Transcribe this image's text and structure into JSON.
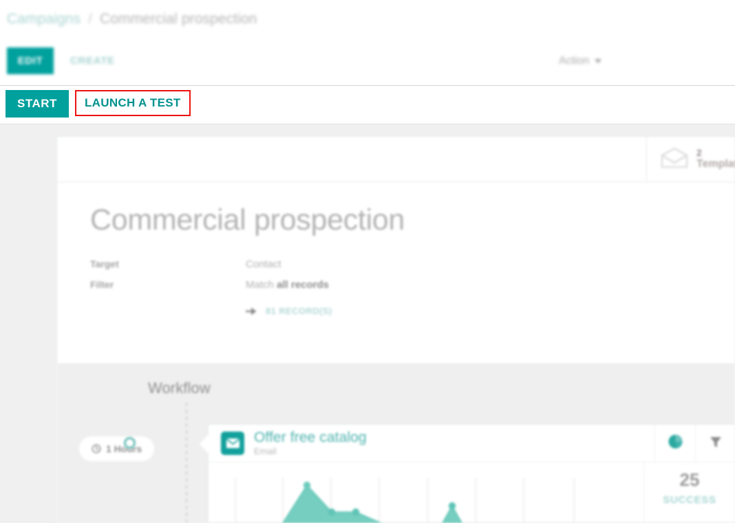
{
  "breadcrumb": {
    "parent": "Campaigns",
    "separator": "/",
    "current": "Commercial prospection"
  },
  "control_bar": {
    "edit_label": "EDIT",
    "create_label": "CREATE",
    "action_label": "Action",
    "action_caret_icon": "chevron-down-icon"
  },
  "action_bar": {
    "start_label": "START",
    "launch_test_label": "LAUNCH A TEST",
    "highlight_color": "#ee1111"
  },
  "record": {
    "title": "Commercial prospection",
    "fields": [
      {
        "label": "Target",
        "value": "Contact",
        "value_bold": ""
      },
      {
        "label": "Filter",
        "value": "Match ",
        "value_bold": "all records"
      }
    ],
    "record_count_label": "81 RECORD(S)",
    "record_count_icon": "arrow-right-icon"
  },
  "stats_strip": {
    "templates": {
      "icon": "open-envelope-icon",
      "count": "2",
      "label": "Templates"
    }
  },
  "workflow": {
    "title": "Workflow",
    "delay_badge": {
      "icon": "clock-icon",
      "text": "1 Hours"
    },
    "activity": {
      "type_icon": "envelope-icon",
      "title": "Offer free catalog",
      "subtitle": "Email",
      "chart_button_icon": "pie-chart-icon",
      "filter_button_icon": "funnel-icon",
      "stat_number": "25",
      "stat_caption": "SUCCESS"
    }
  },
  "colors": {
    "accent_teal": "#00a09d",
    "accent_teal_light": "#4cb3ae",
    "chart_fill": "#6ecbbd",
    "muted_gray": "#b3b3b3",
    "canvas_gray": "#f0f0f0",
    "workflow_gray": "#efefef"
  },
  "chart_data": {
    "type": "area",
    "title": "",
    "xlabel": "",
    "ylabel": "",
    "grid": true,
    "legend": "none",
    "ylim": [
      0,
      30
    ],
    "x": [
      0,
      1,
      2,
      3,
      4,
      5,
      6,
      7,
      8,
      9,
      10,
      11,
      12,
      13,
      14,
      15,
      16
    ],
    "values": [
      0,
      0,
      0,
      0,
      0,
      0,
      25,
      14,
      14,
      0,
      0,
      0,
      11,
      0,
      0,
      0,
      0
    ],
    "gridlines_x": [
      341,
      410,
      480,
      550,
      620,
      690,
      760,
      833
    ],
    "point_markers": [
      {
        "x": 445,
        "y": 703,
        "value": 25
      },
      {
        "x": 481,
        "y": 742,
        "value": 14
      },
      {
        "x": 516,
        "y": 742,
        "value": 14
      },
      {
        "x": 656,
        "y": 733,
        "value": 11
      }
    ]
  }
}
